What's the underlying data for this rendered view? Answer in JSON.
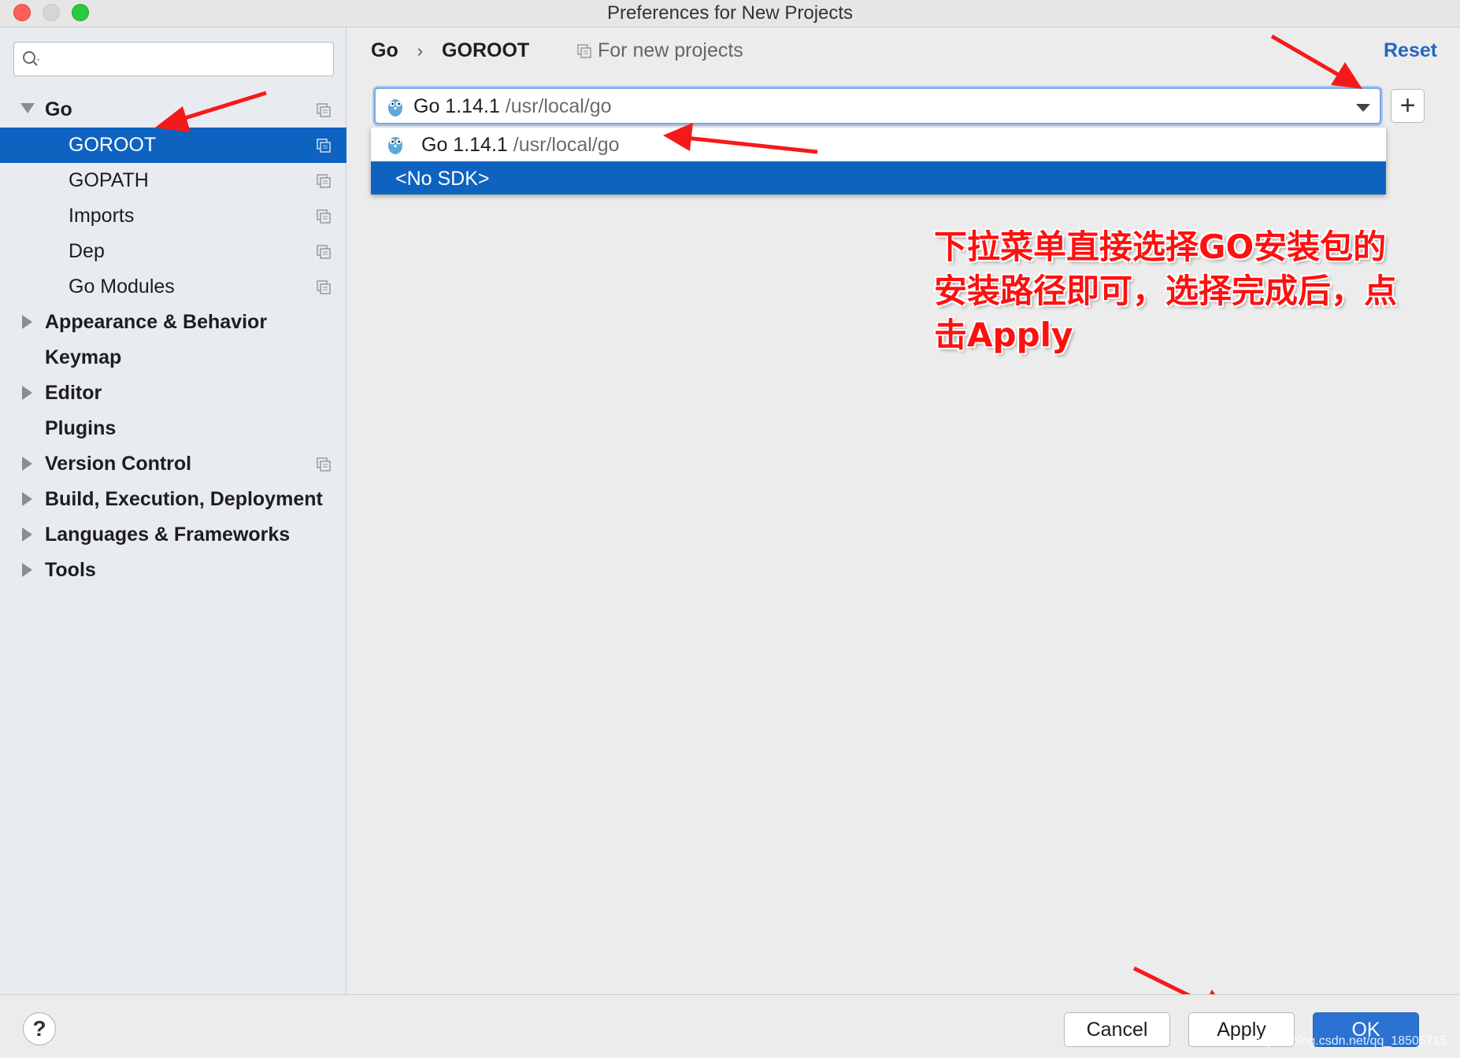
{
  "window": {
    "title": "Preferences for New Projects"
  },
  "search": {
    "placeholder": ""
  },
  "sidebar": {
    "items": [
      {
        "label": "Go"
      },
      {
        "label": "GOROOT"
      },
      {
        "label": "GOPATH"
      },
      {
        "label": "Imports"
      },
      {
        "label": "Dep"
      },
      {
        "label": "Go Modules"
      },
      {
        "label": "Appearance & Behavior"
      },
      {
        "label": "Keymap"
      },
      {
        "label": "Editor"
      },
      {
        "label": "Plugins"
      },
      {
        "label": "Version Control"
      },
      {
        "label": "Build, Execution, Deployment"
      },
      {
        "label": "Languages & Frameworks"
      },
      {
        "label": "Tools"
      }
    ]
  },
  "breadcrumb": {
    "parent": "Go",
    "separator": "›",
    "current": "GOROOT"
  },
  "scope": {
    "label": "For new projects"
  },
  "reset": {
    "label": "Reset"
  },
  "sdk": {
    "selected_name": "Go 1.14.1",
    "selected_path": "/usr/local/go",
    "options": [
      {
        "name": "Go 1.14.1",
        "path": "/usr/local/go"
      },
      {
        "name": "<No SDK>",
        "path": ""
      }
    ]
  },
  "add_button": {
    "label": "+"
  },
  "annotation": {
    "text": "下拉菜单直接选择GO安装包的安装路径即可，选择完成后，点击Apply"
  },
  "footer": {
    "help_label": "?",
    "cancel_label": "Cancel",
    "apply_label": "Apply",
    "ok_label": "OK",
    "watermark": "https://blog.csdn.net/qq_18505715"
  },
  "colors": {
    "selection": "#0f63c0",
    "link": "#2566c1",
    "annotation": "#ff1010",
    "ok_button": "#2c72d2"
  }
}
